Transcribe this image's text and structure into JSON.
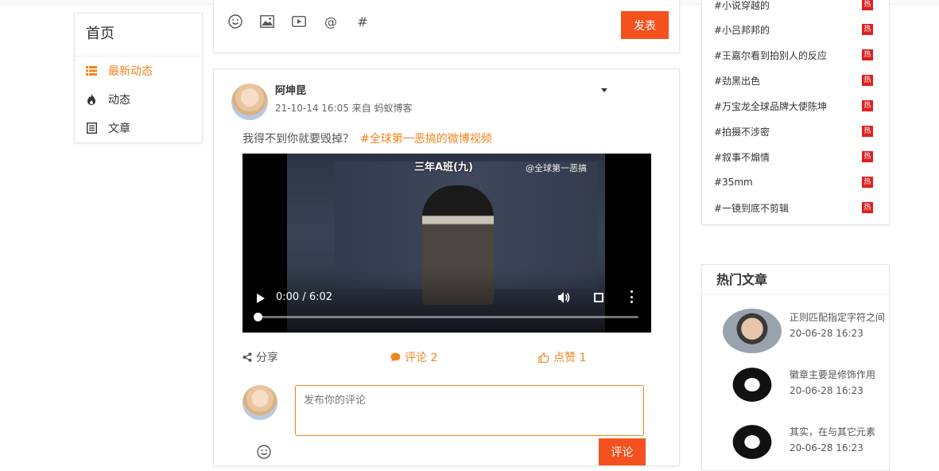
{
  "nav": {
    "title": "首页",
    "items": [
      {
        "label": "最新动态",
        "icon": "list-icon",
        "active": true
      },
      {
        "label": "动态",
        "icon": "fire-icon",
        "active": false
      },
      {
        "label": "文章",
        "icon": "article-icon",
        "active": false
      }
    ]
  },
  "composer": {
    "tools": [
      "emoji-icon",
      "image-icon",
      "video-icon",
      "at-icon",
      "hashtag-icon"
    ],
    "at_glyph": "@",
    "hash_glyph": "#",
    "post_label": "发表"
  },
  "post": {
    "author": "阿坤昆",
    "meta": "21-10-14 16:05 来自 蚂蚁博客",
    "text": "我得不到你就要毁掉？",
    "tag": "#全球第一恶搞的微博视频",
    "video": {
      "caption": "三年A班(九)",
      "watermark": "@全球第一恶搞",
      "time": "0:00 / 6:02",
      "progress": 0
    },
    "actions": {
      "share": "分享",
      "comment": "评论 2",
      "like": "点赞 1"
    },
    "comment_placeholder": "发布你的评论",
    "comment_button": "评论"
  },
  "hot_topics": {
    "badge": "热",
    "items": [
      "#小说穿越的",
      "#小吕邦邦的",
      "#王嘉尔看到拍别人的反应",
      "#劲黑出色",
      "#万宝龙全球品牌大使陈坤",
      "#拍摄不涉密",
      "#叙事不煽情",
      "#35mm",
      "#一镜到底不剪辑"
    ]
  },
  "hot_articles": {
    "title": "热门文章",
    "items": [
      {
        "title": "正则匹配指定字符之间",
        "date": "20-06-28 16:23"
      },
      {
        "title": "徽章主要是修饰作用",
        "date": "20-06-28 16:23"
      },
      {
        "title": "其实，在与其它元素",
        "date": "20-06-28 16:23"
      }
    ]
  },
  "colors": {
    "accent": "#f0851e",
    "button": "#f4511e",
    "hot_badge": "#e02020"
  }
}
